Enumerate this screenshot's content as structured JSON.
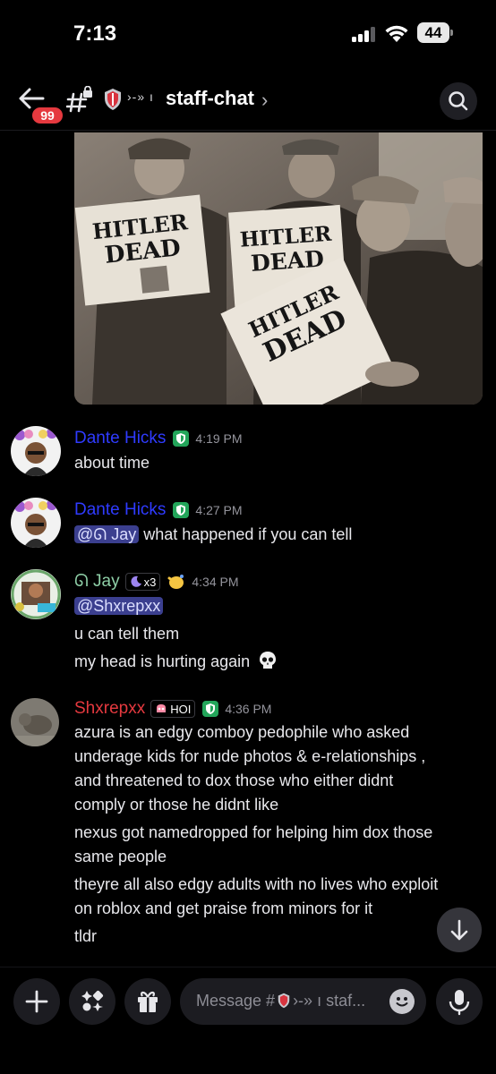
{
  "status": {
    "time": "7:13",
    "battery": "44"
  },
  "header": {
    "unread_count": "99",
    "channel_deco": "›-» ı",
    "channel_name": "staff-chat",
    "chevron": "›"
  },
  "messages": [
    {
      "author": "Dante Hicks",
      "author_color": "#2f3bff",
      "time": "4:19 PM",
      "lines": [
        "about time"
      ]
    },
    {
      "author": "Dante Hicks",
      "author_color": "#2f3bff",
      "time": "4:27 PM",
      "mention": "@ᘏ Jay",
      "lines": [
        "what happened if you can tell"
      ]
    },
    {
      "author": "ᘏ Jay",
      "author_color": "#8fd0a8",
      "badge": "x3",
      "time": "4:34 PM",
      "mention": "@Shxrepxx",
      "lines": [
        "u can tell them",
        "my head is hurting again"
      ]
    },
    {
      "author": "Shxrepxx",
      "author_color": "#e5393f",
      "tag": "HOI",
      "time": "4:36 PM",
      "lines": [
        "azura is an edgy comboy pedophile who asked",
        "underage kids for nude photos & e-relationships ,",
        "and threatened to dox those who either didnt",
        "comply or those he didnt like",
        "nexus got namedropped for helping him dox those",
        "same people",
        "theyre all also edgy adults with no lives who exploit",
        "on roblox and get praise from minors for it",
        "tldr"
      ]
    }
  ],
  "composer": {
    "placeholder": "Message #",
    "placeholder_tail": "›-» ı staf..."
  },
  "icons": {
    "back": "arrow-left-icon",
    "search": "search-icon",
    "plus": "plus-icon",
    "apps": "apps-icon",
    "gift": "gift-icon",
    "mic": "microphone-icon",
    "emoji": "emoji-icon",
    "scroll": "arrow-down-icon"
  },
  "colors": {
    "mention_bg": "#3b3f8f",
    "badge_red": "#e5393f",
    "shield_green": "#23a55a"
  }
}
